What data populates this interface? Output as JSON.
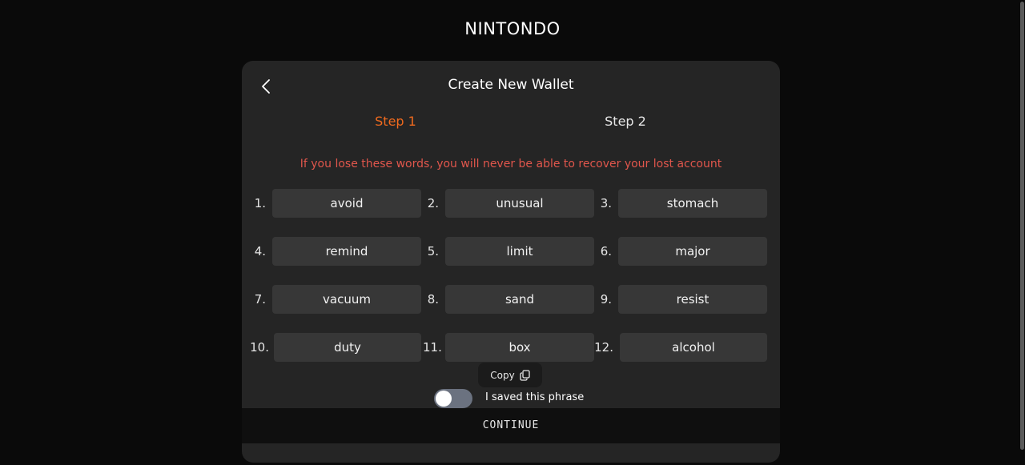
{
  "brand": "NINTONDO",
  "header": {
    "title": "Create New Wallet"
  },
  "steps": [
    {
      "label": "Step 1",
      "active": true
    },
    {
      "label": "Step 2",
      "active": false
    }
  ],
  "warning": "If you lose these words, you will never be able to recover your lost account",
  "words": [
    {
      "num": "1.",
      "word": "avoid"
    },
    {
      "num": "2.",
      "word": "unusual"
    },
    {
      "num": "3.",
      "word": "stomach"
    },
    {
      "num": "4.",
      "word": "remind"
    },
    {
      "num": "5.",
      "word": "limit"
    },
    {
      "num": "6.",
      "word": "major"
    },
    {
      "num": "7.",
      "word": "vacuum"
    },
    {
      "num": "8.",
      "word": "sand"
    },
    {
      "num": "9.",
      "word": "resist"
    },
    {
      "num": "10.",
      "word": "duty"
    },
    {
      "num": "11.",
      "word": "box"
    },
    {
      "num": "12.",
      "word": "alcohol"
    }
  ],
  "copy_label": "Copy",
  "saved_toggle": {
    "label": "I saved this phrase",
    "checked": false
  },
  "continue_label": "CONTINUE",
  "colors": {
    "accent": "#f06a1e",
    "warning": "#e0564c",
    "card": "#252525",
    "chip": "#373737"
  },
  "icons": {
    "back": "chevron-left-icon",
    "copy": "copy-icon"
  }
}
